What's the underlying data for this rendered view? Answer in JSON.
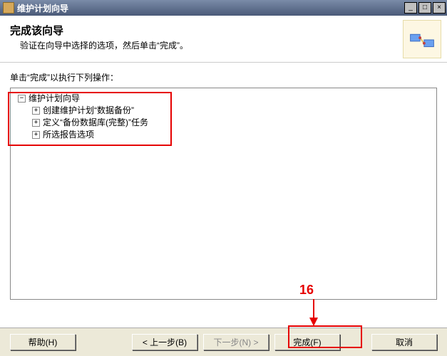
{
  "window": {
    "title": "维护计划向导"
  },
  "header": {
    "title": "完成该向导",
    "subtitle": "验证在向导中选择的选项，然后单击“完成”。"
  },
  "instruction": "单击“完成”以执行下列操作：",
  "tree": {
    "rootLabel": "维护计划向导",
    "items": [
      "创建维护计划“数据备份”",
      "定义“备份数据库(完整)”任务",
      "所选报告选项"
    ]
  },
  "buttons": {
    "help": "帮助(H)",
    "back": "< 上一步(B)",
    "next": "下一步(N) >",
    "finish": "完成(F)",
    "cancel": "取消"
  },
  "annotation": {
    "label": "16"
  }
}
